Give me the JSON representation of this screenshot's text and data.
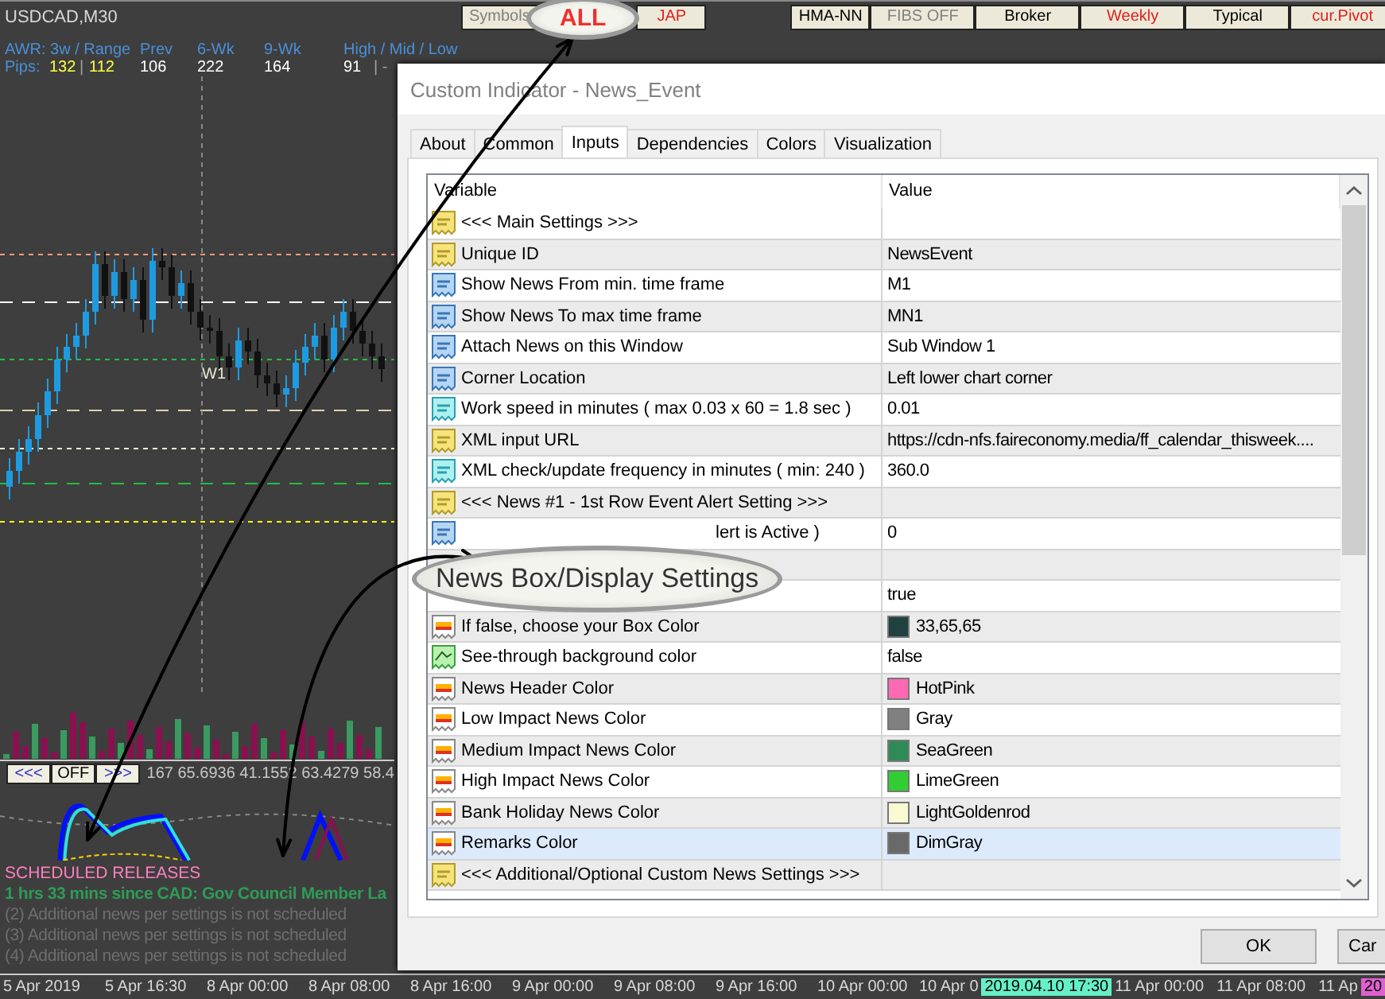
{
  "toolbar": {
    "symbol": "USDCAD,M30",
    "left": [
      {
        "label": "Symbols",
        "color": "#808080"
      },
      {
        "label": "JAP",
        "color": "#e02020"
      }
    ],
    "right": [
      {
        "label": "HMA-NN",
        "color": "#000000"
      },
      {
        "label": "FIBS OFF",
        "color": "#808080"
      },
      {
        "label": "Broker",
        "color": "#000000"
      },
      {
        "label": "Weekly",
        "color": "#e02020"
      },
      {
        "label": "Typical",
        "color": "#000000"
      },
      {
        "label": "cur.Pivot",
        "color": "#e02020"
      }
    ]
  },
  "chart": {
    "awr_header": [
      "AWR: 3w / Range",
      "Prev",
      "6-Wk",
      "9-Wk",
      "High / Mid / Low"
    ],
    "pips": [
      {
        "text": "Pips:",
        "color": "#4a8fd8"
      },
      {
        "text": "132",
        "color": "#ffff40"
      },
      {
        "text": "|",
        "color": "#a0a0a0"
      },
      {
        "text": "112",
        "color": "#ffff40"
      },
      {
        "text": "106",
        "color": "#ffffff"
      },
      {
        "text": "222",
        "color": "#ffffff"
      },
      {
        "text": "164",
        "color": "#ffffff"
      },
      {
        "text": "91",
        "color": "#ffffff"
      },
      {
        "text": "| -",
        "color": "#a0a0a0"
      }
    ],
    "level_label": "W1",
    "nav_buttons": [
      "<<<",
      "OFF",
      ">>>"
    ],
    "readout": "167 65.6936 41.1552 63.4279 58.4",
    "news": {
      "title": "SCHEDULED RELEASES",
      "lines": [
        {
          "text": "1 hrs 33 mins since CAD: Gov Council Member La",
          "kind": "active"
        },
        {
          "text": "(2)  Additional news per settings is not scheduled",
          "kind": "idle"
        },
        {
          "text": "(3)  Additional news per settings is not scheduled",
          "kind": "idle"
        },
        {
          "text": "(4)  Additional news per settings is not scheduled",
          "kind": "idle"
        }
      ]
    }
  },
  "dialog": {
    "title": "Custom Indicator - News_Event",
    "tabs": [
      {
        "label": "About",
        "selected": false
      },
      {
        "label": "Common",
        "selected": false
      },
      {
        "label": "Inputs",
        "selected": true
      },
      {
        "label": "Dependencies",
        "selected": false
      },
      {
        "label": "Colors",
        "selected": false
      },
      {
        "label": "Visualization",
        "selected": false
      }
    ],
    "columns": [
      "Variable",
      "Value"
    ],
    "rows": [
      {
        "kind": "text",
        "label": "<<< Main Settings >>>",
        "selected": false
      },
      {
        "kind": "text",
        "label": "Unique ID",
        "value": "NewsEvent",
        "selected": false
      },
      {
        "kind": "int",
        "label": "Show News From min. time frame",
        "value": "M1",
        "selected": false
      },
      {
        "kind": "int",
        "label": "Show News To max time frame",
        "value": "MN1",
        "selected": false
      },
      {
        "kind": "int",
        "label": "Attach News on this Window",
        "value": "Sub Window 1",
        "selected": false
      },
      {
        "kind": "int",
        "label": "Corner Location",
        "value": "Left lower chart corner",
        "selected": false
      },
      {
        "kind": "double",
        "label": "Work speed in minutes ( max 0.03 x 60 = 1.8 sec )",
        "value": "0.01",
        "selected": false
      },
      {
        "kind": "text",
        "label": "XML input URL",
        "value": "https://cdn-nfs.faireconomy.media/ff_calendar_thisweek....",
        "selected": false
      },
      {
        "kind": "double",
        "label": "XML check/update frequency in minutes ( min: 240 )",
        "value": "360.0",
        "selected": false
      },
      {
        "kind": "text",
        "label": "<<< News #1 - 1st Row Event Alert Setting >>>",
        "selected": false
      },
      {
        "kind": "int",
        "label": "lert is Active )",
        "covered": true,
        "value": "0",
        "selected": false
      },
      {
        "selected": false
      },
      {
        "value": "true",
        "selected": false
      },
      {
        "kind": "color",
        "label": "If false, choose your Box Color",
        "value": "33,65,65",
        "color": "#214141",
        "selected": false
      },
      {
        "kind": "bool",
        "label": "See-through  background color",
        "value": "false",
        "selected": false
      },
      {
        "kind": "color",
        "label": "News Header Color",
        "value": "HotPink",
        "color": "#ff69b4",
        "selected": false
      },
      {
        "kind": "color",
        "label": "Low Impact News Color",
        "value": "Gray",
        "color": "#808080",
        "selected": false
      },
      {
        "kind": "color",
        "label": "Medium Impact News Color",
        "value": "SeaGreen",
        "color": "#2e8b57",
        "selected": false
      },
      {
        "kind": "color",
        "label": "High Impact News Color",
        "value": "LimeGreen",
        "color": "#32cd32",
        "selected": false
      },
      {
        "kind": "color",
        "label": "Bank Holiday News Color",
        "value": "LightGoldenrod",
        "color": "#fafad2",
        "selected": false
      },
      {
        "kind": "color",
        "label": "Remarks Color",
        "value": "DimGray",
        "color": "#696969",
        "selected": true
      },
      {
        "kind": "text",
        "label": "<<< Additional/Optional Custom News Settings >>>",
        "selected": false
      }
    ],
    "buttons": [
      "OK",
      "Car"
    ]
  },
  "callouts": [
    "ALL",
    "News Box/Display Settings"
  ],
  "time_axis": [
    {
      "text": "5 Apr 2019",
      "kind": "tick"
    },
    {
      "text": "5 Apr 16:30",
      "kind": "tick"
    },
    {
      "text": "8 Apr 00:00",
      "kind": "tick"
    },
    {
      "text": "8 Apr 08:00",
      "kind": "tick"
    },
    {
      "text": "8 Apr 16:00",
      "kind": "tick"
    },
    {
      "text": "9 Apr 00:00",
      "kind": "tick"
    },
    {
      "text": "9 Apr 08:00",
      "kind": "tick"
    },
    {
      "text": "9 Apr 16:00",
      "kind": "tick"
    },
    {
      "text": "10 Apr 00:00",
      "kind": "tick"
    },
    {
      "text": "10 Apr 0",
      "kind": "cut"
    },
    {
      "text": "2019.04.10 17:30",
      "kind": "marker",
      "color": "#66f0c8"
    },
    {
      "text": "11 Apr 00:00",
      "kind": "tick"
    },
    {
      "text": "11 Apr 08:00",
      "kind": "tick"
    },
    {
      "text": "11 Ap",
      "kind": "cut"
    },
    {
      "text": "20",
      "kind": "marker",
      "color": "#e060d0"
    }
  ]
}
